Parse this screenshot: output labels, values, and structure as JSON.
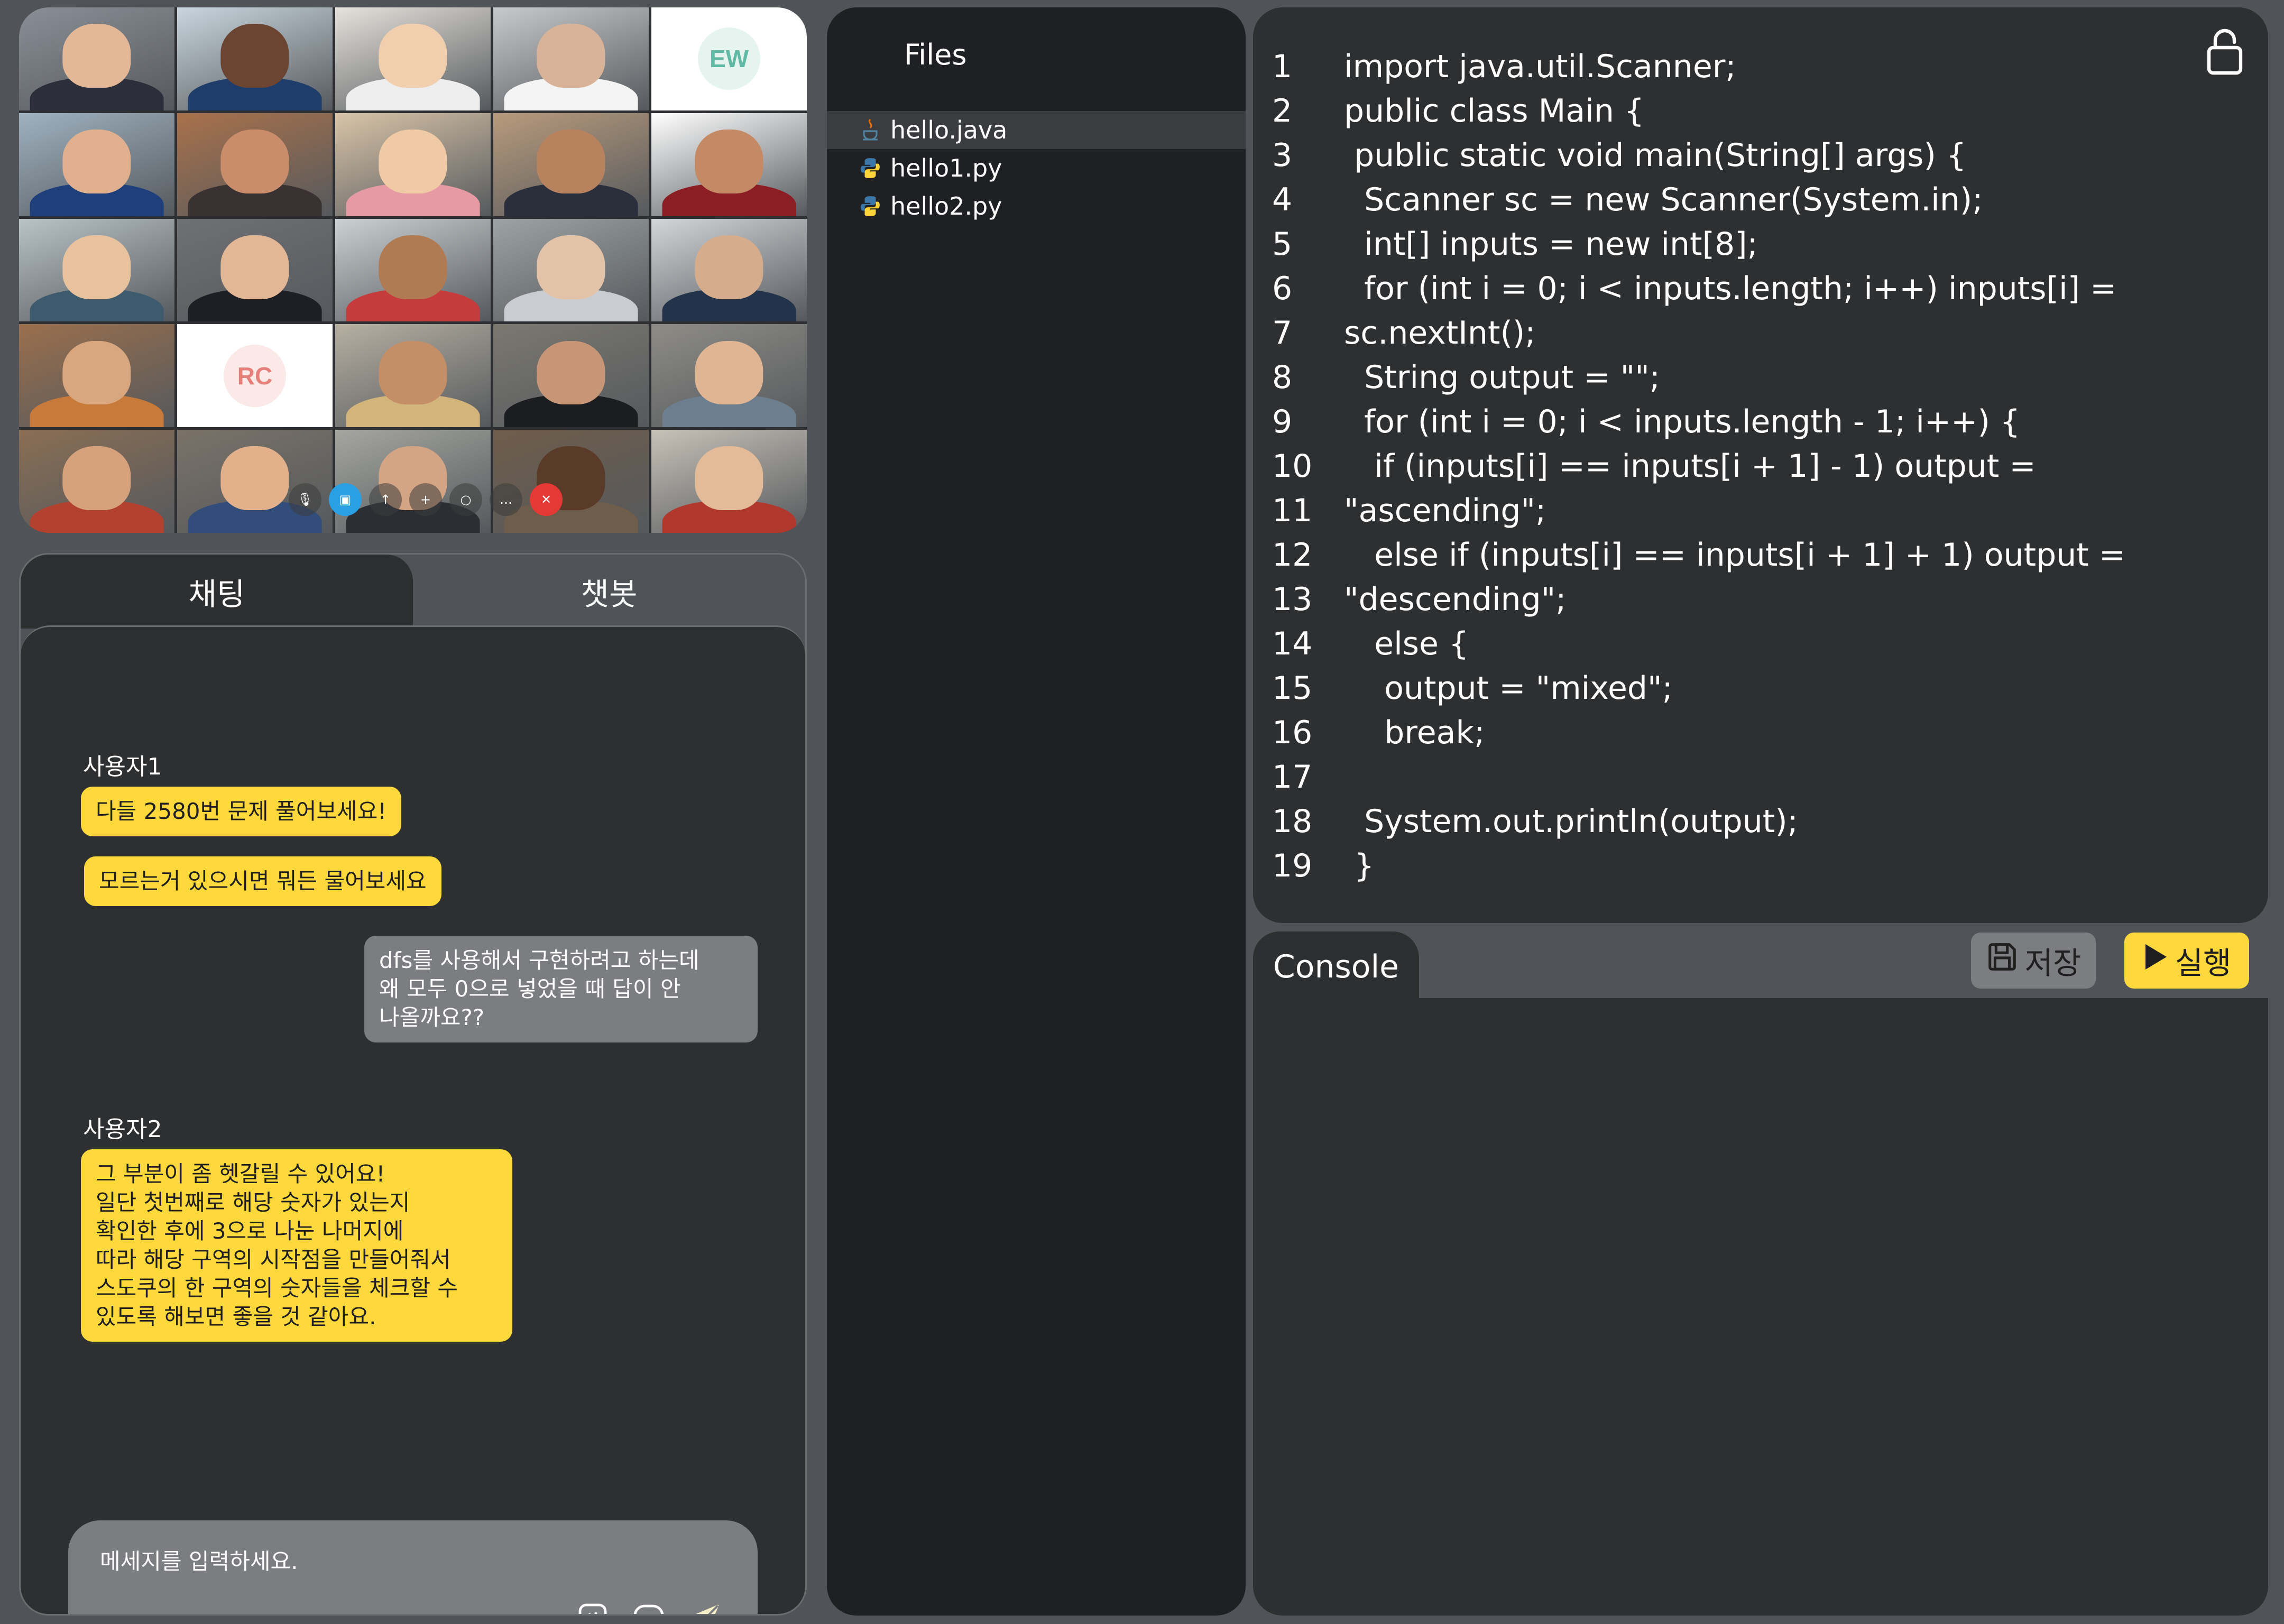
{
  "video": {
    "initials": [
      "EW",
      "RC"
    ]
  },
  "chat": {
    "tabs": [
      "채팅",
      "챗봇"
    ],
    "messages": [
      {
        "sender": "사용자1",
        "text": "다들 2580번 문제 풀어보세요!",
        "side": "left"
      },
      {
        "sender": "",
        "text": "모르는거 있으시면 뭐든 물어보세요",
        "side": "left"
      },
      {
        "sender": "",
        "text": "dfs를 사용해서 구현하려고 하는데\n왜 모두 0으로 넣었을 때 답이 안\n나올까요??",
        "side": "right"
      },
      {
        "sender": "사용자2",
        "text": "그 부분이 좀 헷갈릴 수 있어요!\n일단 첫번째로 해당 숫자가 있는지\n확인한 후에 3으로 나눈 나머지에\n따라 해당 구역의 시작점을 만들어줘서\n스도쿠의 한 구역의 숫자들을 체크할 수\n있도록 해보면 좋을 것 같아요.",
        "side": "left"
      }
    ],
    "input_placeholder": "메세지를 입력하세요."
  },
  "files": {
    "title": "Files",
    "items": [
      {
        "name": "hello.java",
        "icon": "java-icon",
        "selected": true
      },
      {
        "name": "hello1.py",
        "icon": "python-icon",
        "selected": false
      },
      {
        "name": "hello2.py",
        "icon": "python-icon",
        "selected": false
      }
    ]
  },
  "editor": {
    "lines": [
      "import java.util.Scanner;",
      "public class Main {",
      " public static void main(String[] args) {",
      "  Scanner sc = new Scanner(System.in);",
      "  int[] inputs = new int[8];",
      "  for (int i = 0; i < inputs.length; i++) inputs[i] =",
      "sc.nextInt();",
      "  String output = \"\";",
      "  for (int i = 0; i < inputs.length - 1; i++) {",
      "   if (inputs[i] == inputs[i + 1] - 1) output =",
      "\"ascending\";",
      "   else if (inputs[i] == inputs[i + 1] + 1) output =",
      "\"descending\";",
      "   else {",
      "    output = \"mixed\";",
      "    break;",
      "",
      "  System.out.println(output);",
      " }"
    ]
  },
  "console": {
    "tab_label": "Console",
    "save_label": "저장",
    "run_label": "실행"
  },
  "colors": {
    "background": "#505458",
    "panel": "#2e2f31",
    "files_panel": "#1f2024",
    "accent_yellow": "#ffd93c",
    "bubble_grey": "#7b7d80",
    "active_tile_border": "#3fa9e8",
    "end_call_red": "#e53935"
  }
}
